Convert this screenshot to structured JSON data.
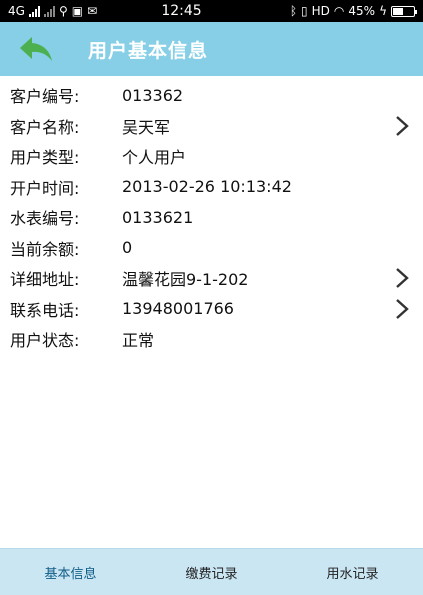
{
  "status_bar": {
    "network": "4G",
    "time": "12:45",
    "hd": "HD",
    "battery": "45%"
  },
  "header": {
    "title": "用户基本信息",
    "back_icon": "back-arrow-icon"
  },
  "fields": [
    {
      "label": "客户编号:",
      "value": "013362"
    },
    {
      "label": "客户名称:",
      "value": "吴天军"
    },
    {
      "label": "用户类型:",
      "value": "个人用户"
    },
    {
      "label": "开户时间:",
      "value": "2013-02-26 10:13:42"
    },
    {
      "label": "水表编号:",
      "value": "0133621"
    },
    {
      "label": "当前余额:",
      "value": "0"
    },
    {
      "label": "详细地址:",
      "value": "温馨花园9-1-202"
    },
    {
      "label": "联系电话:",
      "value": "13948001766"
    },
    {
      "label": "用户状态:",
      "value": "正常"
    }
  ],
  "tabs": [
    {
      "label": "基本信息"
    },
    {
      "label": "缴费记录"
    },
    {
      "label": "用水记录"
    }
  ],
  "colors": {
    "header_bg": "#86cfe6",
    "tab_bar_bg": "#cbe6f3",
    "back_arrow": "#4caf50",
    "active_tab": "#0f5c87"
  }
}
